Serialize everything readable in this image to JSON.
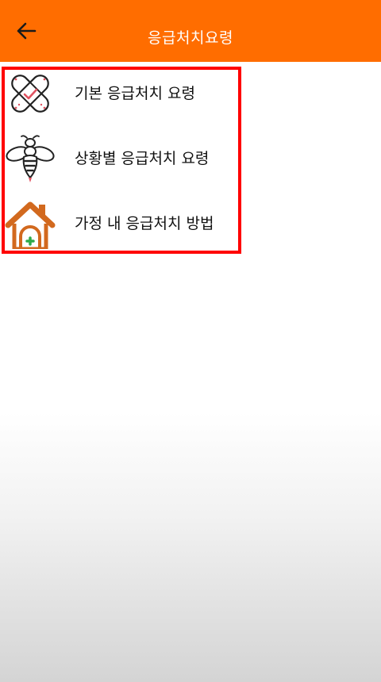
{
  "app_bar": {
    "title": "응급처치요령",
    "back_icon": "arrow-left-icon",
    "color": "#FF6D00"
  },
  "highlight": {
    "color": "#FF0000"
  },
  "menu": {
    "items": [
      {
        "label": "기본 응급처치 요령",
        "icon": "bandage-icon"
      },
      {
        "label": "상황별 응급처치 요령",
        "icon": "bee-icon"
      },
      {
        "label": "가정 내 응급처치 방법",
        "icon": "home-firstaid-icon"
      }
    ]
  }
}
